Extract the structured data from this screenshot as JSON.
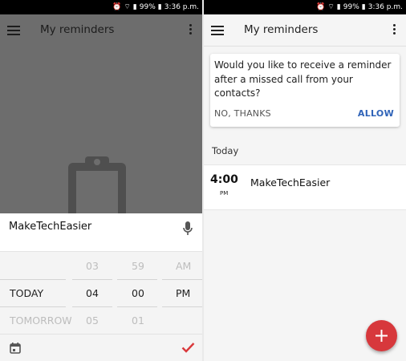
{
  "status_bar": {
    "battery": "99%",
    "time": "3:36 p.m."
  },
  "left": {
    "title": "My reminders",
    "reminder_input": "MakeTechEasier",
    "picker": {
      "day_prev": "",
      "day_selected": "TODAY",
      "day_next": "TOMORROW",
      "hour_prev": "03",
      "hour_selected": "04",
      "hour_next": "05",
      "minute_prev": "59",
      "minute_selected": "00",
      "minute_next": "01",
      "ampm_prev": "AM",
      "ampm_selected": "PM"
    },
    "accent_color": "#d9383b"
  },
  "right": {
    "title": "My reminders",
    "card": {
      "text": "Would you like to receive a reminder after a missed call from your contacts?",
      "decline_label": "NO, THANKS",
      "accept_label": "ALLOW"
    },
    "section": "Today",
    "reminders": [
      {
        "time": "4:00",
        "ampm": "PM",
        "title": "MakeTechEasier"
      }
    ],
    "fab_color": "#d7383c",
    "link_color": "#2f63b8"
  }
}
